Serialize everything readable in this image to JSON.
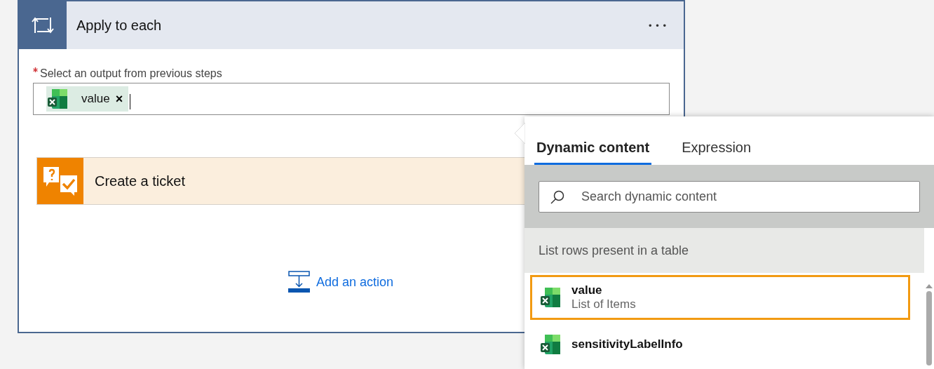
{
  "card": {
    "title": "Apply to each",
    "more": "• • •",
    "field": {
      "label": "Select an output from previous steps",
      "required": true,
      "token": {
        "label": "value",
        "remove": "×"
      }
    },
    "action": {
      "title": "Create a ticket"
    },
    "add_action": "Add an action"
  },
  "panel": {
    "tabs": [
      {
        "label": "Dynamic content",
        "selected": true
      },
      {
        "label": "Expression",
        "selected": false
      }
    ],
    "search": {
      "placeholder": "Search dynamic content"
    },
    "group": "List rows present in a table",
    "items": [
      {
        "name": "value",
        "description": "List of Items",
        "selected": true
      },
      {
        "name": "sensitivityLabelInfo",
        "selected": false
      }
    ]
  }
}
